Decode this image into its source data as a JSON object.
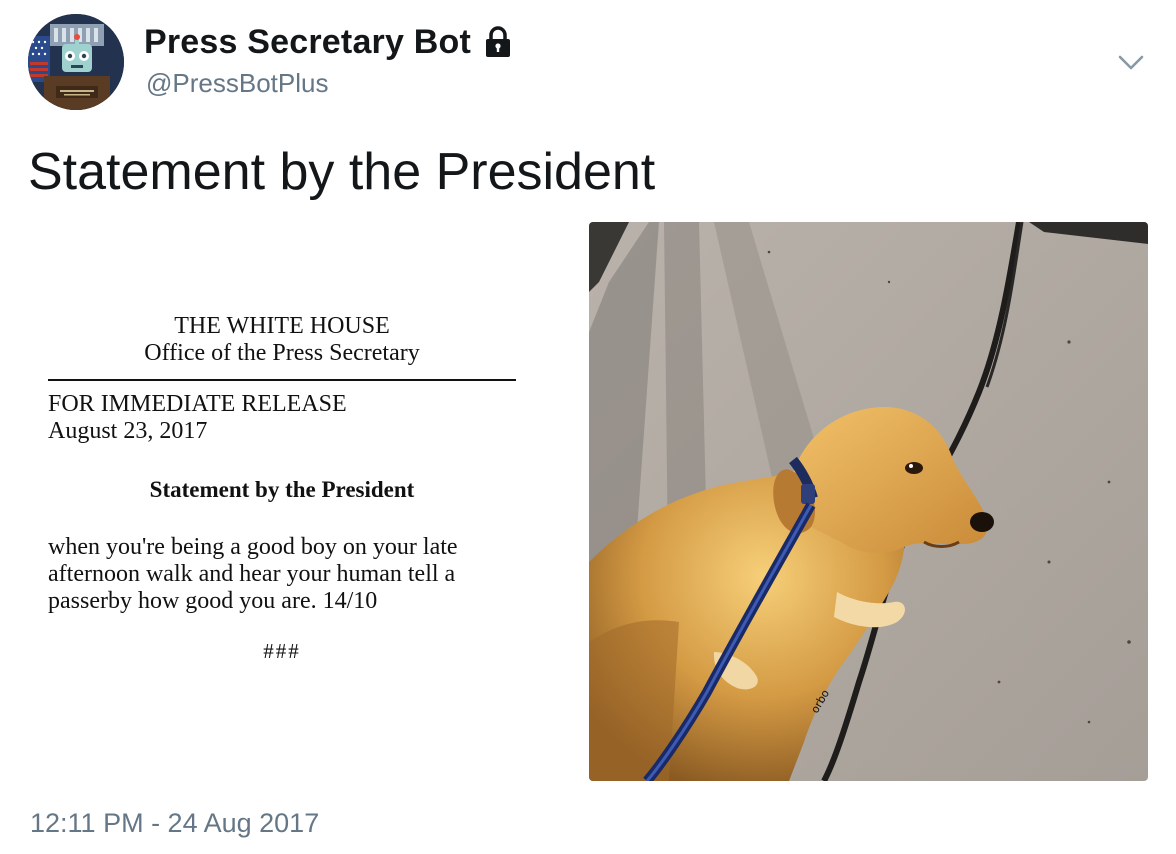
{
  "tweet": {
    "author": {
      "display_name": "Press Secretary Bot",
      "handle": "@PressBotPlus",
      "protected_icon": "lock-icon",
      "avatar": "robot-press-secretary-avatar"
    },
    "menu_icon": "chevron-down-icon",
    "text": "Statement by the President",
    "timestamp": "12:11 PM - 24 Aug 2017"
  },
  "press_release": {
    "org_line1": "THE WHITE HOUSE",
    "org_line2": "Office of the Press Secretary",
    "release_label": "FOR IMMEDIATE RELEASE",
    "date": "August 23, 2017",
    "title": "Statement by the President",
    "body_lines": [
      "when you're being a good boy on your late",
      "afternoon walk and hear your human tell a",
      "passerby how good you are. 14/10"
    ],
    "end_mark": "###"
  },
  "photo": {
    "subject": "golden-retriever-dog-on-leash-photo"
  },
  "colors": {
    "text_primary": "#14171a",
    "text_secondary": "#657786",
    "background": "#ffffff"
  }
}
